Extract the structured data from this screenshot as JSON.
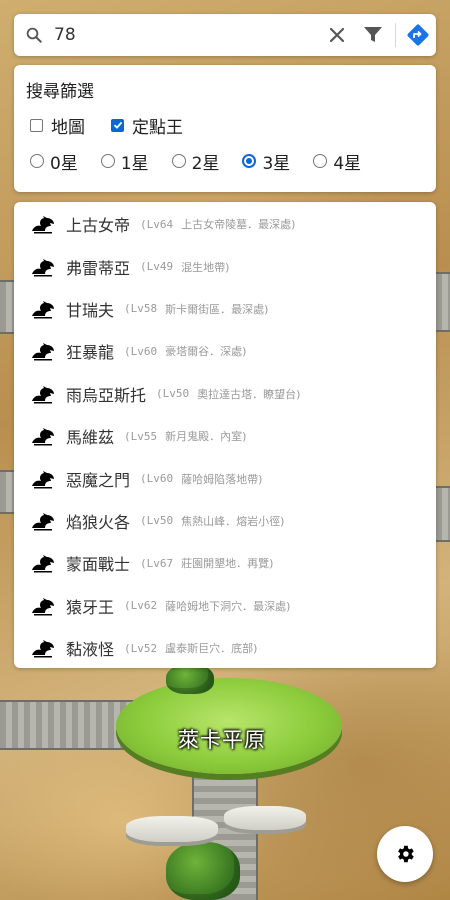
{
  "search": {
    "value": "78",
    "icons": {
      "search": "search-icon",
      "clear": "close-icon",
      "filter": "filter-icon",
      "directions": "directions-icon"
    }
  },
  "filter": {
    "title": "搜尋篩選",
    "checkboxes": [
      {
        "label": "地圖",
        "checked": false
      },
      {
        "label": "定點王",
        "checked": true
      }
    ],
    "radios": [
      {
        "label": "0星",
        "checked": false
      },
      {
        "label": "1星",
        "checked": false
      },
      {
        "label": "2星",
        "checked": false
      },
      {
        "label": "3星",
        "checked": true
      },
      {
        "label": "4星",
        "checked": false
      }
    ]
  },
  "results": [
    {
      "name": "上古女帝",
      "level": "(Lv64",
      "location": "上古女帝陵墓．最深處)"
    },
    {
      "name": "弗雷蒂亞",
      "level": "(Lv49",
      "location": "混生地帶)"
    },
    {
      "name": "甘瑞夫",
      "level": "(Lv58",
      "location": "斯卡爾街區．最深處)"
    },
    {
      "name": "狂暴龍",
      "level": "(Lv60",
      "location": "豪塔爾谷．深處)"
    },
    {
      "name": "雨烏亞斯托",
      "level": "(Lv50",
      "location": "奧拉達古塔．瞭望台)"
    },
    {
      "name": "馬維茲",
      "level": "(Lv55",
      "location": "新月鬼殿．內室)"
    },
    {
      "name": "惡魔之門",
      "level": "(Lv60",
      "location": "薩哈姆陷落地帶)"
    },
    {
      "name": "焰狼火各",
      "level": "(Lv50",
      "location": "焦熱山峰．熔岩小徑)"
    },
    {
      "name": "蒙面戰士",
      "level": "(Lv67",
      "location": "莊園開墾地．再覽)"
    },
    {
      "name": "猿牙王",
      "level": "(Lv62",
      "location": "薩哈姆地下洞穴．最深處)"
    },
    {
      "name": "黏液怪",
      "level": "(Lv52",
      "location": "盧泰斯巨穴．底部)"
    }
  ],
  "map": {
    "region_label": "萊卡平原"
  },
  "colors": {
    "accent": "#0b66d6",
    "icon": "#000000",
    "muted_text": "#9a9a9a"
  }
}
